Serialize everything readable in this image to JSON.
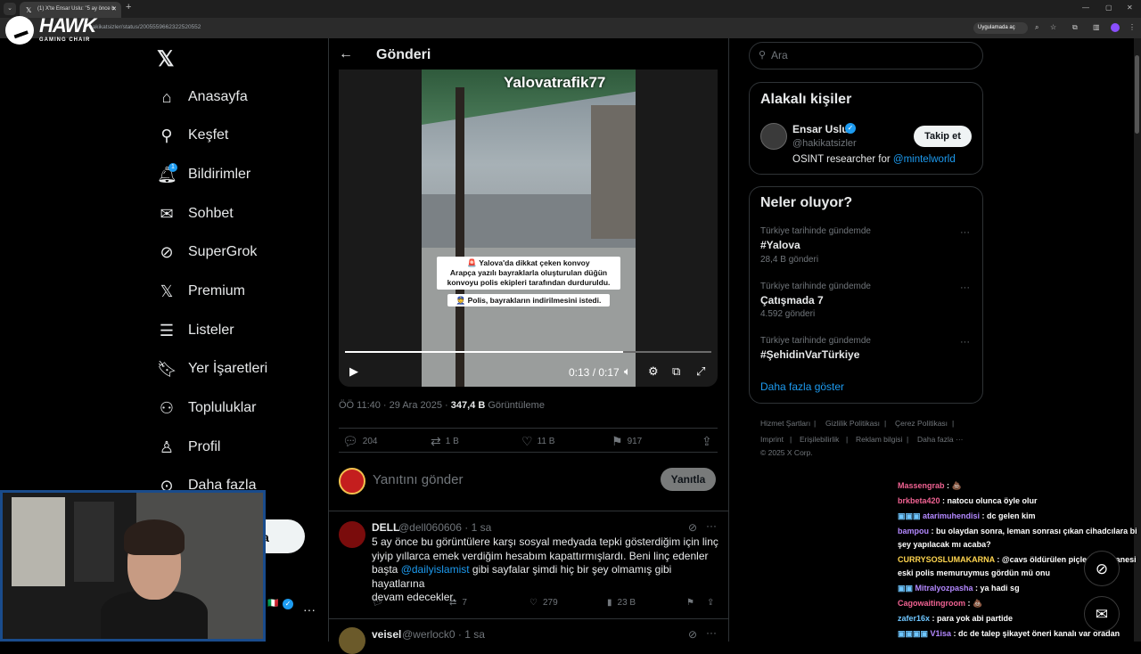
{
  "browser": {
    "tab_title": "(1) X'te Ensar Uslu: \"5 ay önce b",
    "url": "hakikatsizler/status/2005559662322520552",
    "open_in_app": "Uygulamada aç"
  },
  "overlay_logo": {
    "title": "HAWK",
    "subtitle": "GAMING CHAIR"
  },
  "nav": {
    "items": [
      {
        "label": "Anasayfa"
      },
      {
        "label": "Keşfet"
      },
      {
        "label": "Bildirimler",
        "badge": "1"
      },
      {
        "label": "Sohbet"
      },
      {
        "label": "SuperGrok"
      },
      {
        "label": "Premium"
      },
      {
        "label": "Listeler"
      },
      {
        "label": "Yer İşaretleri"
      },
      {
        "label": "Topluluklar"
      },
      {
        "label": "Profil"
      },
      {
        "label": "Daha fazla"
      }
    ],
    "post_button_label": "a"
  },
  "post": {
    "header": "Gönderi",
    "video": {
      "watermark": "Yalovatrafik77",
      "caption_line1": "🚨 Yalova'da dikkat çeken konvoy",
      "caption_line2": "Arapça yazılı bayraklarla oluşturulan düğün",
      "caption_line3": "konvoyu polis ekipleri tarafından durduruldu.",
      "caption_line4": "👮 Polis, bayrakların indirilmesini istedi.",
      "time": "0:13 / 0:17",
      "progress": 0.76
    },
    "timestamp": "ÖÖ 11:40 · 29 Ara 2025 · ",
    "views": "347,4 B",
    "views_label": " Görüntüleme",
    "stats": {
      "replies": "204",
      "reposts": "1 B",
      "likes": "11 B",
      "bookmarks": "917"
    },
    "reply_placeholder": "Yanıtını gönder",
    "reply_button": "Yanıtla"
  },
  "replies": [
    {
      "name": "DELL",
      "handle": "@dell060606 · 1 sa",
      "body_1": "5 ay önce bu görüntülere karşı sosyal medyada tepki gösterdiğim için linç",
      "body_2": "yiyip yıllarca emek verdiğim hesabım kapattırmışlardı. Beni linç edenler",
      "body_3_pre": "başta ",
      "mention": "@dailyislamist",
      "body_3_post": " gibi sayfalar şimdi hiç bir şey olmamış gibi hayatlarına",
      "body_4": "devam edecekler.",
      "reposts": "7",
      "likes": "279",
      "views": "23 B"
    },
    {
      "name": "veisel",
      "handle": "@werlock0 · 1 sa"
    }
  ],
  "sidebar": {
    "search_placeholder": "Ara",
    "related_title": "Alakalı kişiler",
    "related": {
      "name": "Ensar Uslu",
      "handle": "@hakikatsizler",
      "bio_pre": "OSINT researcher for ",
      "bio_link": "@mintelworld",
      "follow": "Takip et"
    },
    "trends_title": "Neler oluyor?",
    "trends": [
      {
        "context": "Türkiye tarihinde gündemde",
        "name": "#Yalova",
        "count": "28,4 B gönderi"
      },
      {
        "context": "Türkiye tarihinde gündemde",
        "name": "Çatışmada 7",
        "count": "4.592 gönderi"
      },
      {
        "context": "Türkiye tarihinde gündemde",
        "name": "#ŞehidinVarTürkiye",
        "count": ""
      }
    ],
    "show_more": "Daha fazla göster",
    "footer": [
      "Hizmet Şartları",
      "Gizlilik Politikası",
      "Çerez Politikası",
      "Imprint",
      "Erişilebilirlik",
      "Reklam bilgisi",
      "Daha fazla ···",
      "© 2025 X Corp."
    ]
  },
  "chat": [
    {
      "user": "Massengrab",
      "msg": " : 💩"
    },
    {
      "user": "brkbeta420",
      "msg": " : natocu olunca öyle olur"
    },
    {
      "user": "atarimuhendisi",
      "msg": " : dc gelen kim"
    },
    {
      "user": "bampou",
      "msg": " : bu olaydan sonra, leman sonrası çıkan cihadcılara bi"
    },
    {
      "user": "",
      "msg": "şey yapılacak mı acaba?"
    },
    {
      "user": "CURRYSOSLUMAKARNA",
      "msg": " : @cavs öldürülen piçlerden 2 tanesi"
    },
    {
      "user": "",
      "msg": "eski polis memuruymus gördün mü onu"
    },
    {
      "user": "Mitralyozpasha",
      "msg": " : ya hadi sg"
    },
    {
      "user": "Cagowaitingroom",
      "msg": " : 💩"
    },
    {
      "user": "zafer16x",
      "msg": " : para yok abi partide"
    },
    {
      "user": "V1isa",
      "msg": " : dc de talep şikayet öneri kanalı var oradan"
    }
  ]
}
